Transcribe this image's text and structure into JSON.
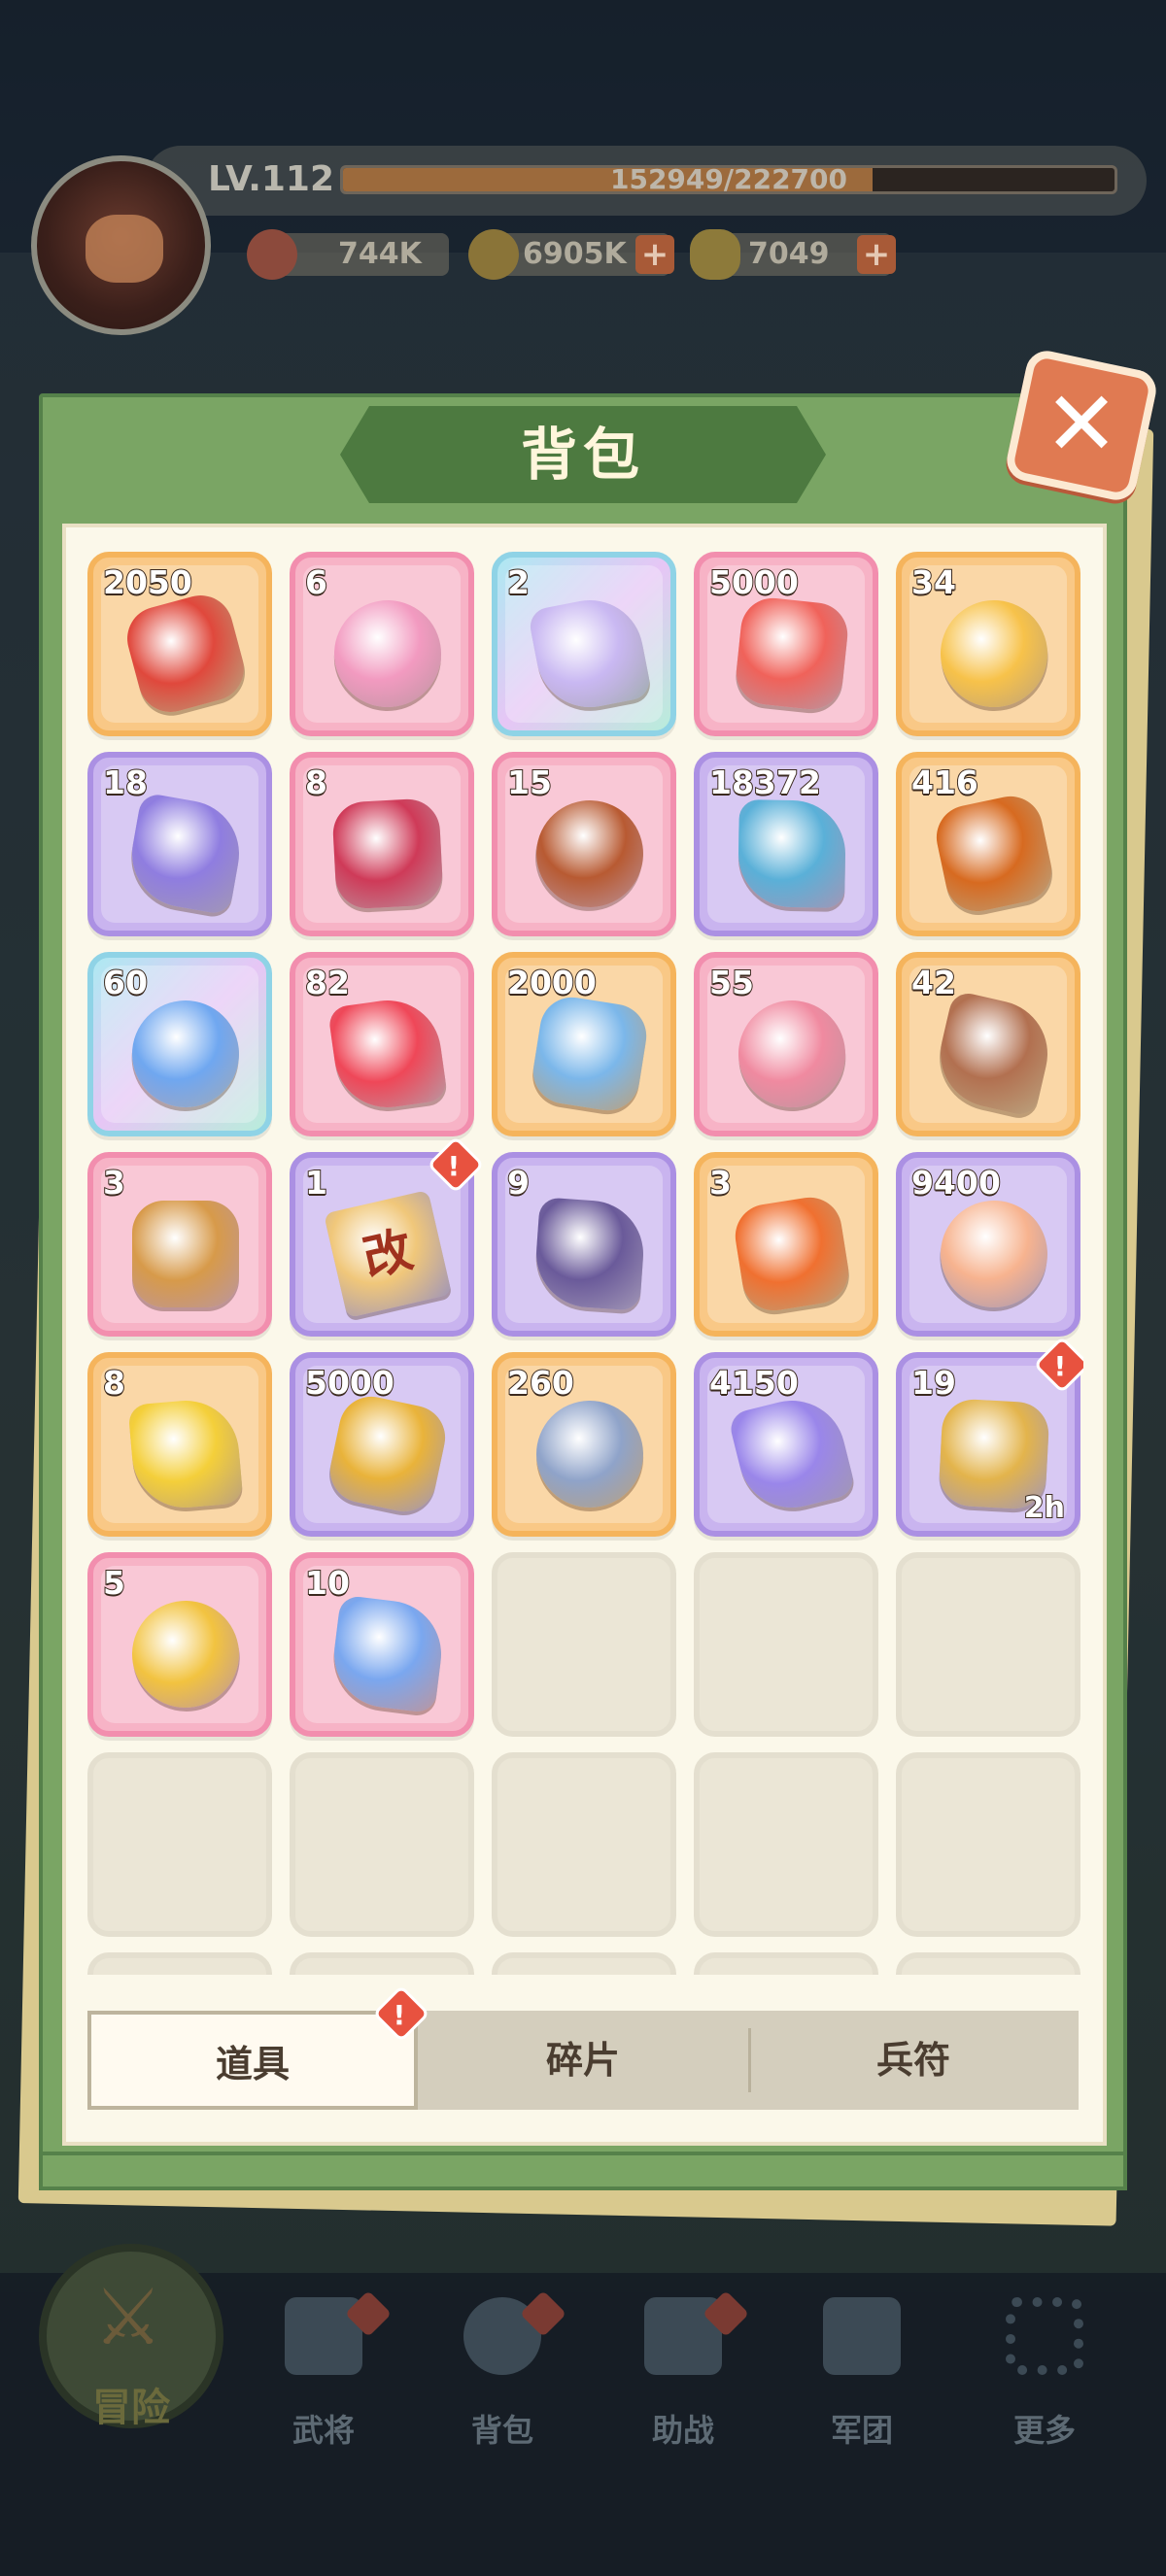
{
  "player": {
    "level": "LV.112",
    "xp_text": "152949/222700",
    "xp_fraction": 0.687,
    "power": "744K",
    "coins": "6905K",
    "ingots": "7049",
    "plus": "+"
  },
  "panel": {
    "title": "背包",
    "close": "✕"
  },
  "items": [
    {
      "qty": "2050",
      "color": "orange",
      "icon": "red-star-badge-icon",
      "hue": "#e0483c"
    },
    {
      "qty": "6",
      "color": "pink",
      "icon": "pink-gem-ring-icon",
      "hue": "#f29ac0"
    },
    {
      "qty": "2",
      "color": "rainbow",
      "icon": "rainbow-gem-ring-icon",
      "hue": "#c9b8f2"
    },
    {
      "qty": "5000",
      "color": "pink",
      "icon": "red-crystal-icon",
      "hue": "#f0625a"
    },
    {
      "qty": "34",
      "color": "orange",
      "icon": "yellow-crystal-icon",
      "hue": "#f7c24a"
    },
    {
      "qty": "18",
      "color": "purple",
      "icon": "purple-crystal-icon",
      "hue": "#8f7de0"
    },
    {
      "qty": "8",
      "color": "pink",
      "icon": "ruby-orb-icon",
      "hue": "#cf3a58"
    },
    {
      "qty": "15",
      "color": "pink",
      "icon": "hammer-icon",
      "hue": "#b85a32"
    },
    {
      "qty": "18372",
      "color": "purple",
      "icon": "colored-orbs-tray-icon",
      "hue": "#5ab0d8"
    },
    {
      "qty": "416",
      "color": "orange",
      "icon": "general-token-shield-icon",
      "hue": "#d76a20"
    },
    {
      "qty": "60",
      "color": "rainbow",
      "icon": "blue-flame-icon",
      "hue": "#6fa7f0"
    },
    {
      "qty": "82",
      "color": "pink",
      "icon": "red-flame-icon",
      "hue": "#ef4758"
    },
    {
      "qty": "2000",
      "color": "orange",
      "icon": "blue-ore-icon",
      "hue": "#7bb7ea"
    },
    {
      "qty": "55",
      "color": "pink",
      "icon": "pink-crystal-cluster-icon",
      "hue": "#f08aa0"
    },
    {
      "qty": "42",
      "color": "orange",
      "icon": "bronze-crystal-cluster-icon",
      "hue": "#b27050"
    },
    {
      "qty": "3",
      "color": "pink",
      "icon": "winged-flower-emblem-icon",
      "hue": "#d79a4a"
    },
    {
      "qty": "1",
      "color": "purple",
      "icon": "rename-card-icon",
      "hue": "#f0c77a",
      "label": "改",
      "alert": true
    },
    {
      "qty": "9",
      "color": "purple",
      "icon": "dark-crystal-icon",
      "hue": "#6a5a9a"
    },
    {
      "qty": "3",
      "color": "orange",
      "icon": "fire-egg-icon",
      "hue": "#f07030"
    },
    {
      "qty": "9400",
      "color": "purple",
      "icon": "peach-icon",
      "hue": "#f7b38f"
    },
    {
      "qty": "8",
      "color": "orange",
      "icon": "gold-powder-tray-icon",
      "hue": "#f4cf3a"
    },
    {
      "qty": "5000",
      "color": "purple",
      "icon": "star-key-icon",
      "hue": "#e9b33a"
    },
    {
      "qty": "260",
      "color": "orange",
      "icon": "silver-winged-emblem-icon",
      "hue": "#8fa3c9"
    },
    {
      "qty": "4150",
      "color": "purple",
      "icon": "violet-crystal-icon",
      "hue": "#9a86ea"
    },
    {
      "qty": "19",
      "color": "purple",
      "icon": "gold-money-bag-icon",
      "hue": "#e3b44c",
      "timer": "2h",
      "alert": true
    },
    {
      "qty": "5",
      "color": "pink",
      "icon": "golden-gourd-icon",
      "hue": "#f2c340"
    },
    {
      "qty": "10",
      "color": "pink",
      "icon": "blue-swirl-puzzle-icon",
      "hue": "#7aa7ef"
    }
  ],
  "alert_mark": "!",
  "tabs": [
    {
      "label": "道具",
      "active": true,
      "alert": true
    },
    {
      "label": "碎片"
    },
    {
      "label": "兵符"
    }
  ],
  "nav": [
    {
      "label": "冒险",
      "icon": "crossed-swords-icon"
    },
    {
      "label": "武将",
      "icon": "helmet-icon"
    },
    {
      "label": "背包",
      "icon": "bag-icon"
    },
    {
      "label": "助战",
      "icon": "shield-swords-icon"
    },
    {
      "label": "军团",
      "icon": "banner-icon"
    },
    {
      "label": "更多",
      "icon": "grid-icon"
    }
  ]
}
